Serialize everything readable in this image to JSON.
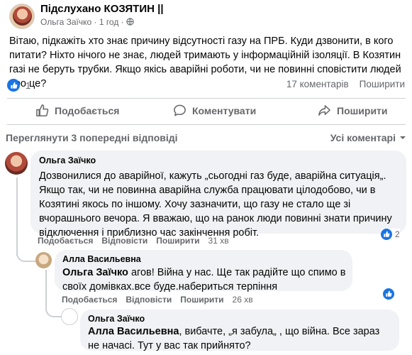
{
  "post": {
    "group_name": "Підслухано КОЗЯТИН ||",
    "author": "Ольга Заїчко",
    "time": "· 1 год ·",
    "text": "Вітаю, підкажіть хто знає причину відсутності газу на ПРБ. Куди дзвонити, в кого питати? Ніхто нічого не знає, людей тримають у інформаційній ізоляції. В Козятин газі не беруть трубки. Якщо якісь аварійні роботи, чи не повинні сповістити людей про це?",
    "reactions_count": "1",
    "comments_count": "17 коментарів",
    "shares_label": "Поширити"
  },
  "actions": {
    "like": "Подобається",
    "comment": "Коментувати",
    "share": "Поширити"
  },
  "comments_header": {
    "previous": "Переглянути 3 попередні відповіді",
    "sort": "Усі коментарі"
  },
  "comments": [
    {
      "name": "Ольга Заїчко",
      "text": "Дозвонилися до аварійної, кажуть „сьогодні газ буде, аварійна ситуація„. Якщо так, чи не повинна аварійна служба працювати цілодобово, чи в Козятині якось по іншому. Хочу зазначити, що газу не стало ще зі вчорашнього вечора. Я вважаю, що на ранок люди повинні знати причину відключення і приблизно час закінчення робіт.",
      "like": "Подобається",
      "reply": "Відповісти",
      "share": "Поширити",
      "time": "31 хв",
      "reactions": "2"
    },
    {
      "name": "Алла Васильевна",
      "mention": "Ольга Заїчко",
      "text": " агов! Війна у нас. Ще так радійте що спимо в своїх домівках.все буде.набериться терпіння",
      "like": "Подобається",
      "reply": "Відповісти",
      "share": "Поширити",
      "time": "26 хв",
      "reactions": ""
    },
    {
      "name": "Ольга Заїчко",
      "mention": "Алла Васильевна",
      "text": ", вибачте, „я забула„ , що війна. Все зараз не начасі. Тут у вас так прийнято?"
    }
  ],
  "colors": {
    "accent": "#1b74e4",
    "muted": "#65676b",
    "bubble": "#f0f2f5"
  }
}
